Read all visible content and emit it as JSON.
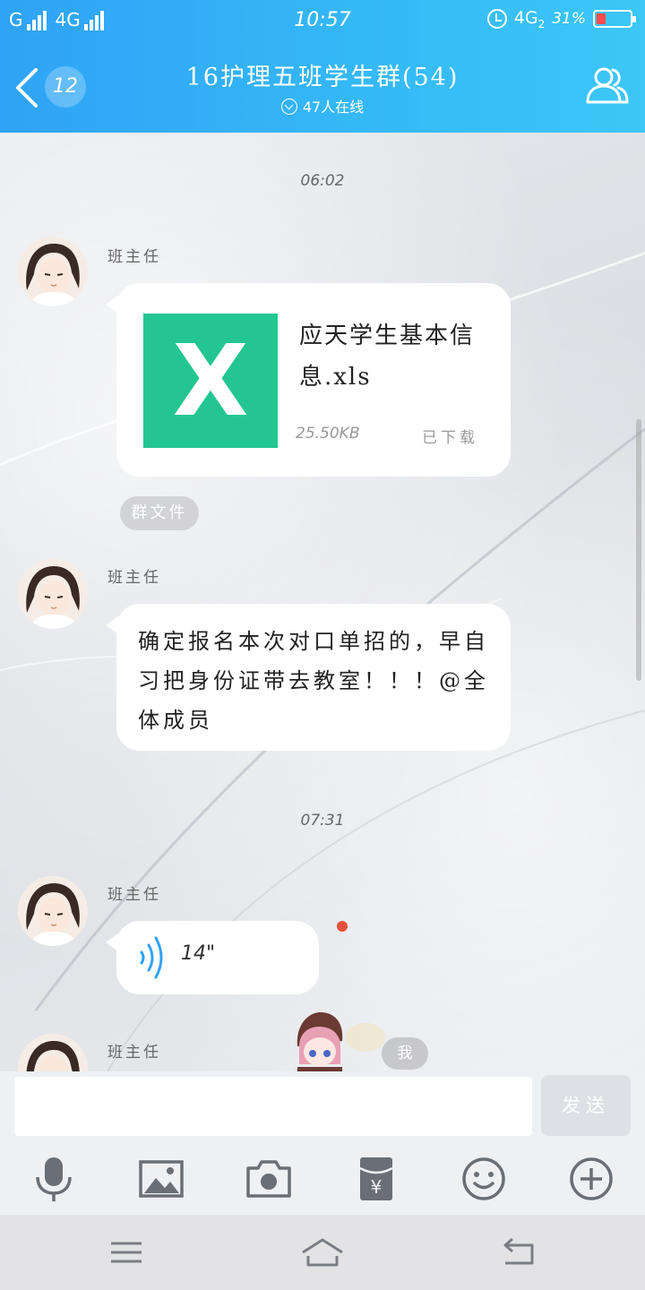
{
  "status_bar": {
    "carrier_left": "G",
    "network": "4G",
    "time": "10:57",
    "network_right": "4G",
    "network_sub": "2",
    "battery": "31%"
  },
  "header": {
    "unread_count": "12",
    "title": "16护理五班学生群(54)",
    "online": "47人在线"
  },
  "messages": [
    {
      "type": "time",
      "text": "06:02"
    },
    {
      "type": "file",
      "sender": "班主任",
      "file_name": "应天学生基本信息.xls",
      "size": "25.50KB",
      "status": "已下载",
      "icon_letter": "X"
    },
    {
      "type": "tag",
      "text": "群文件"
    },
    {
      "type": "text",
      "sender": "班主任",
      "text": "确定报名本次对口单招的，早自习把身份证带去教室！！！@全体成员"
    },
    {
      "type": "time",
      "text": "07:31"
    },
    {
      "type": "voice",
      "sender": "班主任",
      "duration": "14\""
    },
    {
      "type": "partial",
      "sender": "班主任"
    }
  ],
  "sticker_label": "我",
  "input": {
    "value": "",
    "send_label": "发送"
  },
  "toolbar": [
    "microphone-icon",
    "image-icon",
    "camera-icon",
    "red-packet-icon",
    "emoji-icon",
    "plus-icon"
  ],
  "system_nav": [
    "menu-icon",
    "home-icon",
    "back-icon"
  ],
  "colors": {
    "header_start": "#2fa3f5",
    "header_end": "#3cc7f7",
    "xls_green": "#23c690",
    "unread_dot": "#e8503b"
  }
}
